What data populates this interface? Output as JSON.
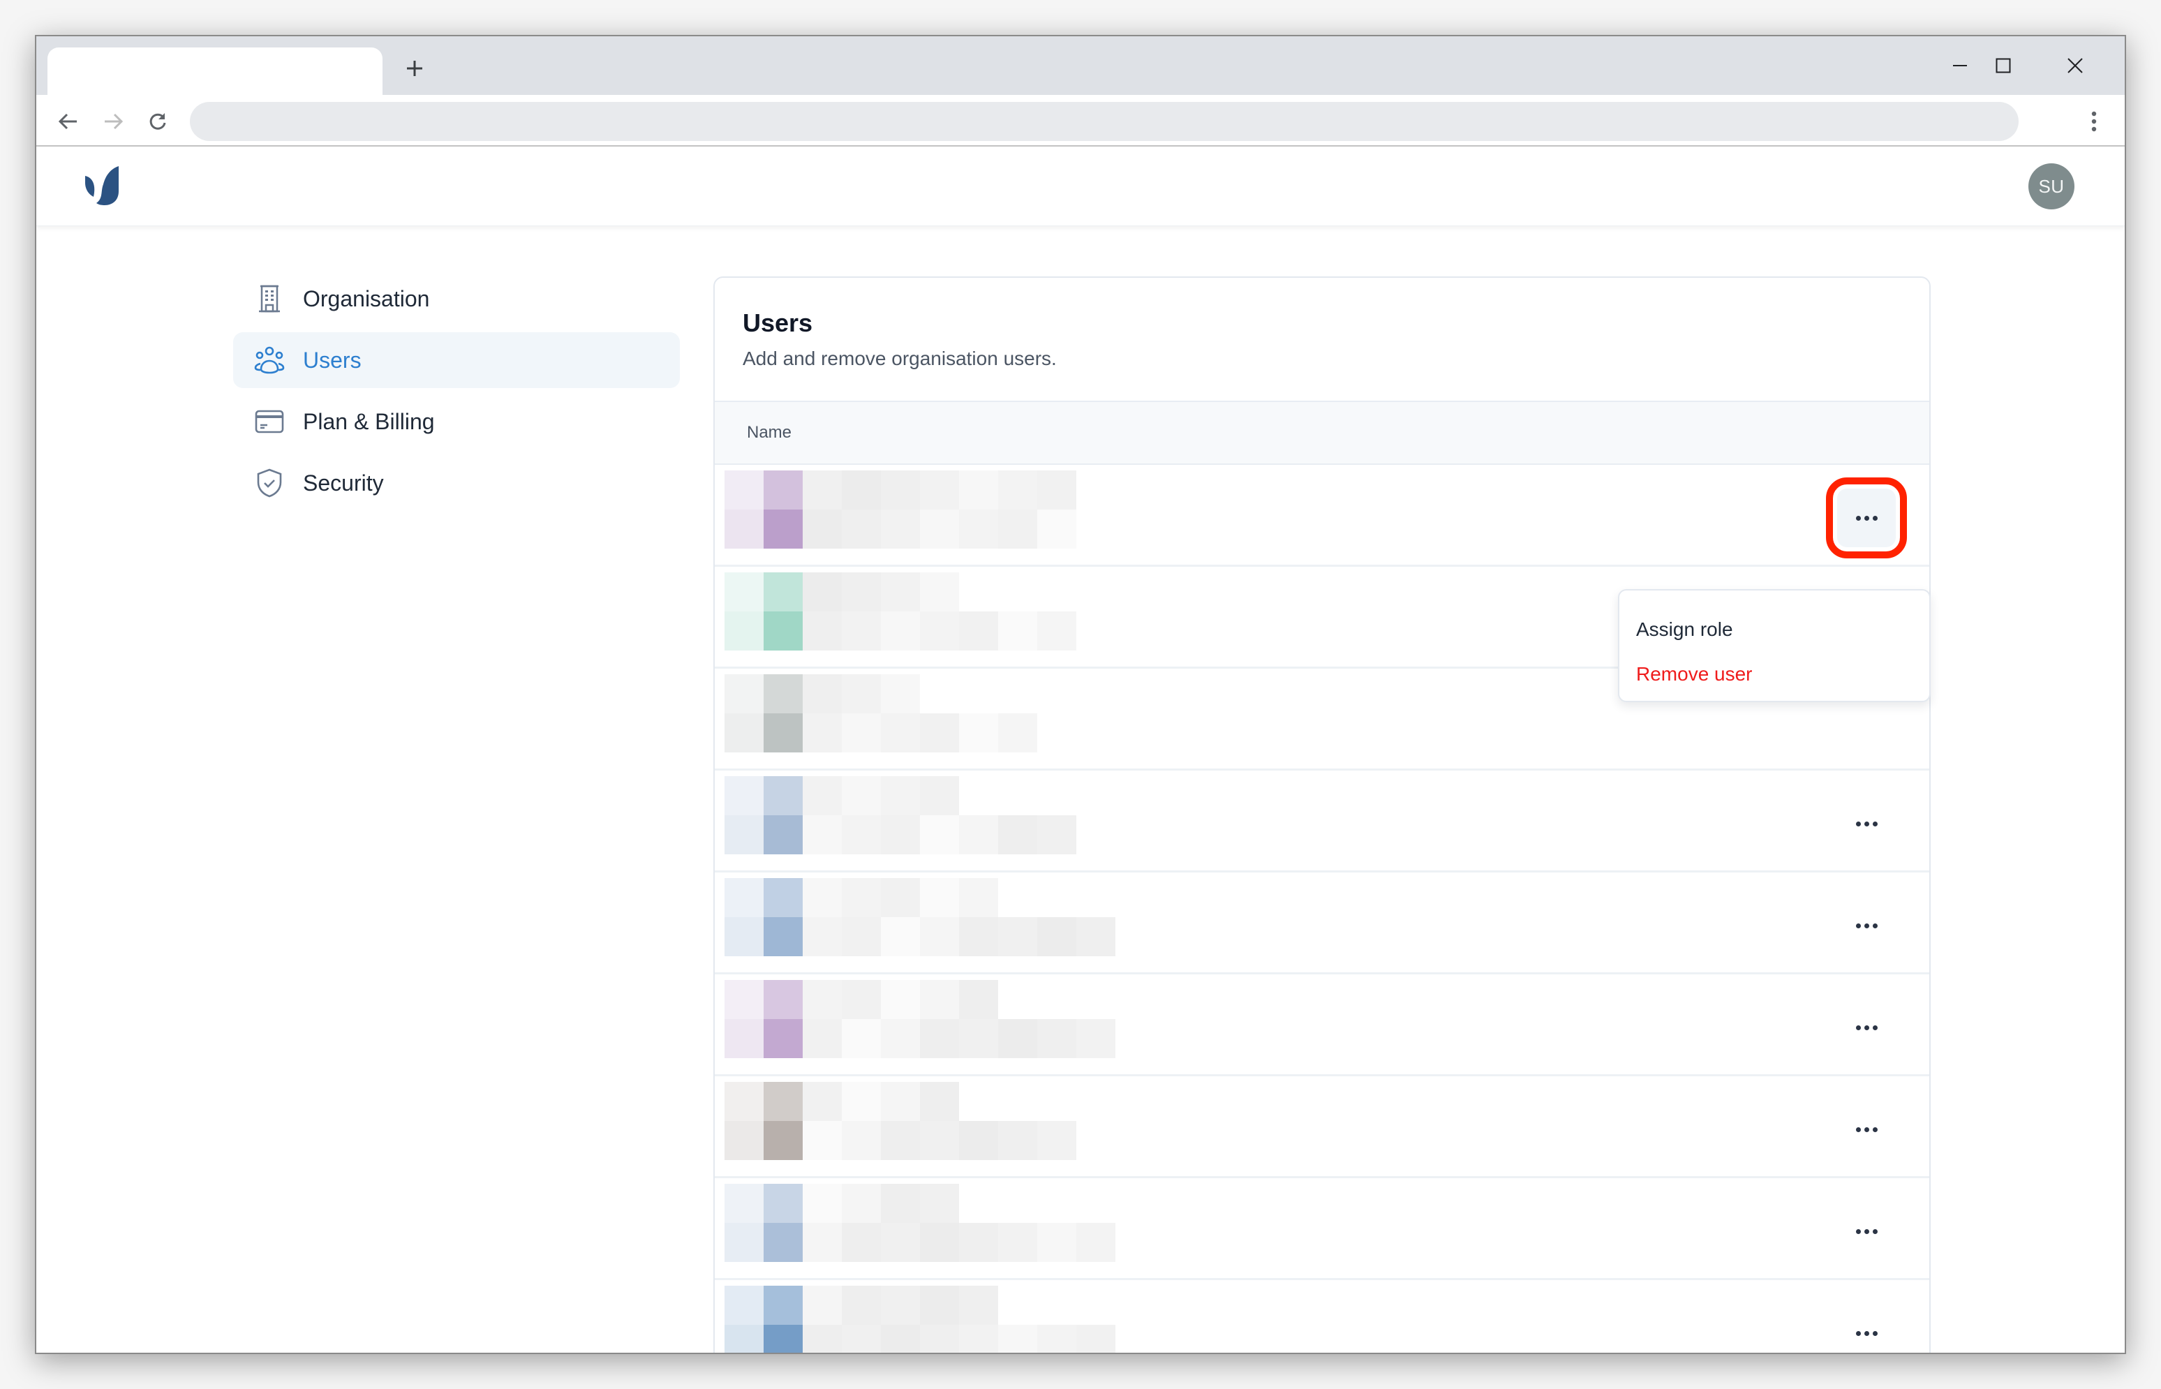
{
  "browser": {
    "tabs": [
      {
        "title": "",
        "active": true
      }
    ],
    "new_tab_label": "+",
    "address_bar": {
      "value": "",
      "placeholder": ""
    },
    "icons": {
      "back": "arrow-left-icon",
      "forward": "arrow-right-icon",
      "reload": "reload-icon",
      "menu": "kebab-vertical-icon",
      "minimize": "minimize-icon",
      "maximize": "maximize-icon",
      "close": "close-icon"
    }
  },
  "app": {
    "logo": "brand-logo",
    "brand_color": "#2b5282",
    "user_avatar": {
      "initials": "SU",
      "color": "#7f8c8d"
    }
  },
  "sidebar": {
    "items": [
      {
        "label": "Organisation",
        "icon": "building-icon",
        "active": false
      },
      {
        "label": "Users",
        "icon": "users-icon",
        "active": true
      },
      {
        "label": "Plan & Billing",
        "icon": "credit-card-icon",
        "active": false
      },
      {
        "label": "Security",
        "icon": "shield-check-icon",
        "active": false
      }
    ],
    "active_color": "#2d7fcf"
  },
  "users_card": {
    "title": "Users",
    "subtitle": "Add and remove organisation users.",
    "columns": [
      "Name"
    ],
    "rows": [
      {
        "name": "[redacted]",
        "avatar_tint": "#bb9fcb",
        "has_actions": true,
        "menu_open": true
      },
      {
        "name": "[redacted]",
        "avatar_tint": "#a0d7c6",
        "has_actions": true,
        "menu_open": false
      },
      {
        "name": "[redacted]",
        "avatar_tint": "#bdc3c2",
        "has_actions": false,
        "menu_open": false
      },
      {
        "name": "[redacted]",
        "avatar_tint": "#a7bbd5",
        "has_actions": true,
        "menu_open": false
      },
      {
        "name": "[redacted]",
        "avatar_tint": "#9eb7d5",
        "has_actions": true,
        "menu_open": false
      },
      {
        "name": "[redacted]",
        "avatar_tint": "#c3a9d1",
        "has_actions": true,
        "menu_open": false
      },
      {
        "name": "[redacted]",
        "avatar_tint": "#b8b0ac",
        "has_actions": true,
        "menu_open": false
      },
      {
        "name": "[redacted]",
        "avatar_tint": "#abbfd9",
        "has_actions": true,
        "menu_open": false
      },
      {
        "name": "[redacted]",
        "avatar_tint": "#759dc7",
        "has_actions": true,
        "menu_open": false
      }
    ],
    "row_menu": {
      "items": [
        {
          "label": "Assign role",
          "variant": "normal"
        },
        {
          "label": "Remove user",
          "variant": "danger"
        }
      ],
      "danger_color": "#ef1c1c"
    },
    "highlight_color": "#ff2200"
  }
}
